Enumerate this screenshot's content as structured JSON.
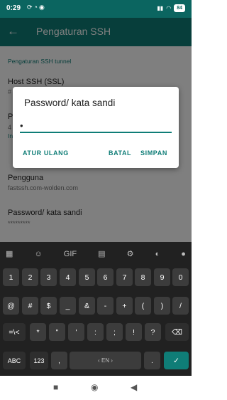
{
  "status_bar": {
    "time": "0:29",
    "status_icons": [
      "sync-icon",
      "signal-icon",
      "at-icon"
    ],
    "battery": "84"
  },
  "app_bar": {
    "title": "Pengaturan SSH"
  },
  "content": {
    "section1_header": "Pengaturan SSH tunnel",
    "host_title": "Host SSH (SSL)",
    "host_sub": "#",
    "port_title": "P",
    "port_sub": "4",
    "section2_header": "In",
    "user_title": "Pengguna",
    "user_value": "fastssh.com-wolden.com",
    "pass_title": "Password/ kata sandi",
    "pass_value": "*********"
  },
  "dialog": {
    "title": "Password/ kata sandi",
    "input_value": "•",
    "reset_label": "ATUR ULANG",
    "cancel_label": "BATAL",
    "save_label": "SIMPAN"
  },
  "keyboard": {
    "row1": [
      "1",
      "2",
      "3",
      "4",
      "5",
      "6",
      "7",
      "8",
      "9",
      "0"
    ],
    "row2": [
      "@",
      "#",
      "$",
      "_",
      "&",
      "-",
      "+",
      "(",
      ")",
      "/"
    ],
    "row3": [
      "*",
      "\"",
      "'",
      ":",
      ";",
      "!",
      "?"
    ],
    "abc_label": "ABC",
    "num_label": "123",
    "comma_label": ",",
    "space_label": "EN",
    "period_label": "."
  },
  "colors": {
    "accent": "#0f7d77",
    "statusbar": "#0b6560",
    "keyboard_bg": "#212121"
  }
}
